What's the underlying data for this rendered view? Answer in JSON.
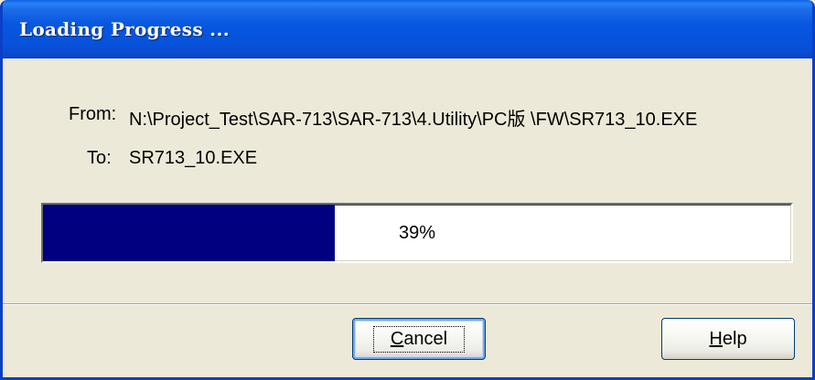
{
  "window": {
    "title": "Loading Progress ..."
  },
  "transfer": {
    "from_label": "From:",
    "from_value": "N:\\Project_Test\\SAR-713\\SAR-713\\4.Utility\\PC版 \\FW\\SR713_10.EXE",
    "to_label": "To:",
    "to_value": "SR713_10.EXE"
  },
  "progress": {
    "percent": 39,
    "text": "39%",
    "fill_color": "#000080"
  },
  "buttons": {
    "cancel": {
      "mnemonic": "C",
      "rest": "ancel"
    },
    "help": {
      "mnemonic": "H",
      "rest": "elp"
    }
  },
  "colors": {
    "titlebar": "#0A5FE8",
    "dialog_bg": "#ECE9D8",
    "title_text": "#FFFFFF"
  }
}
